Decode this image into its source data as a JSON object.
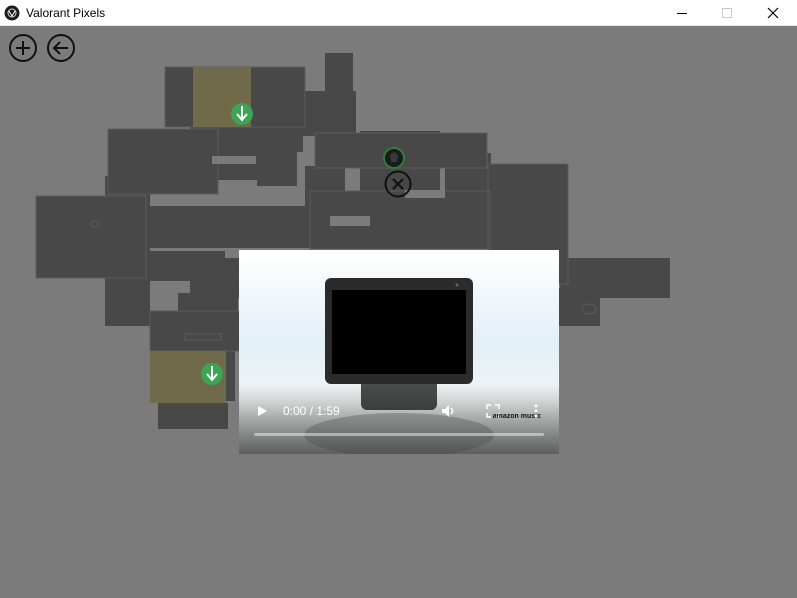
{
  "window": {
    "title": "Valorant Pixels",
    "icon": "valorant-logo-icon",
    "controls": [
      "minimize-icon",
      "maximize-icon",
      "close-icon"
    ]
  },
  "toolbar": {
    "add_icon": "plus-circle-icon",
    "back_icon": "arrow-left-circle-icon"
  },
  "map": {
    "background_color": "#7b7b7b",
    "floor_color": "#484848",
    "site_color": "#6e6a4a",
    "markers": [
      "ability-marker-icon",
      "ability-marker-icon",
      "agent-avatar-icon"
    ],
    "close_marker_icon": "close-circle-icon"
  },
  "video_player": {
    "time_text": "0:00 / 1:59",
    "progress": 0.0,
    "brand_text": "amazon music",
    "controls": [
      "play-icon",
      "volume-icon",
      "fullscreen-icon",
      "more-options-icon"
    ]
  }
}
